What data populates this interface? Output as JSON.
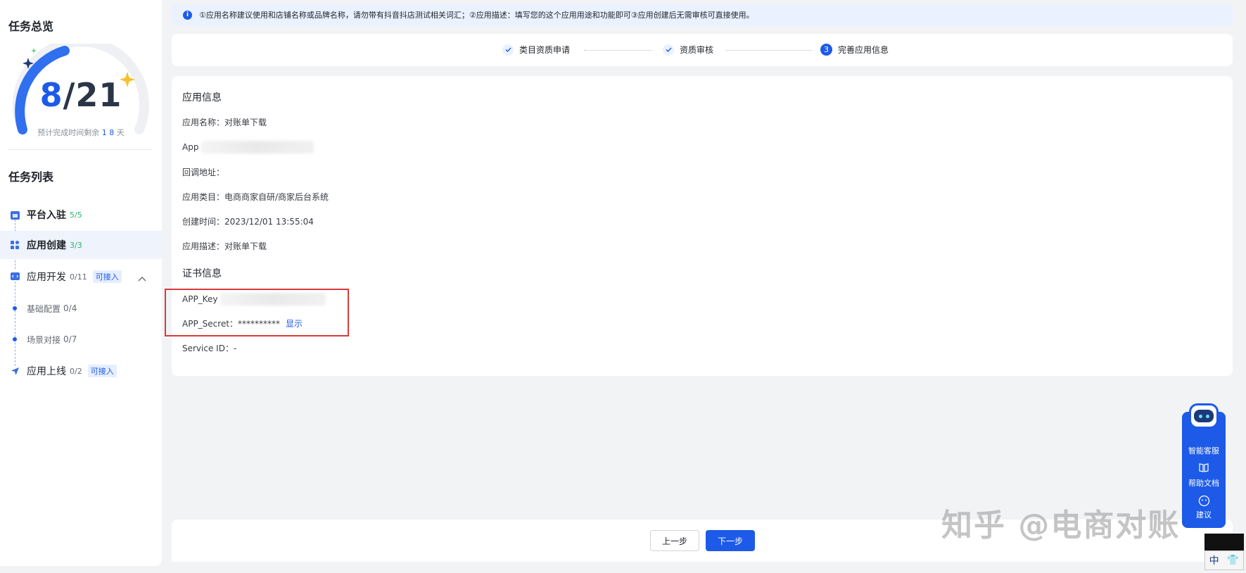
{
  "sidebar": {
    "overview_title": "任务总览",
    "progress": {
      "current": "8",
      "separator": "/",
      "total": "21",
      "fraction": 0.38
    },
    "estimate_prefix": "预计完成时间剩余",
    "estimate_value": "1 8",
    "estimate_suffix": "天",
    "list_title": "任务列表",
    "tasks": [
      {
        "name": "平台入驻",
        "count": "5/5"
      },
      {
        "name": "应用创建",
        "count": "3/3"
      },
      {
        "name": "应用开发",
        "count": "0/11",
        "badge": "可接入"
      },
      {
        "name": "应用上线",
        "count": "0/2",
        "badge": "可接入"
      }
    ],
    "subtasks": [
      {
        "name": "基础配置",
        "count": "0/4"
      },
      {
        "name": "场景对接",
        "count": "0/7"
      }
    ]
  },
  "notice": {
    "text": "①应用名称建议使用和店铺名称或品牌名称，请勿带有抖音抖店测试相关词汇；②应用描述：填写您的这个应用用途和功能即可③应用创建后无需审核可直接使用。"
  },
  "steps": [
    {
      "label": "类目资质申请",
      "status": "done"
    },
    {
      "label": "资质审核",
      "status": "done"
    },
    {
      "label": "完善应用信息",
      "status": "current",
      "number": "3"
    }
  ],
  "app_info": {
    "title": "应用信息",
    "name_label": "应用名称：",
    "name_value": "对账单下载",
    "appid_label": "App",
    "callback_label": "回调地址：",
    "category_label": "应用类目：",
    "category_value": "电商商家自研/商家后台系统",
    "created_label": "创建时间：",
    "created_value": "2023/12/01 13:55:04",
    "desc_label": "应用描述：",
    "desc_value": "对账单下载"
  },
  "cert_info": {
    "title": "证书信息",
    "key_label": "APP_Key",
    "secret_label": "APP_Secret：",
    "secret_value": "**********",
    "show_link": "显示",
    "service_label": "Service ID：",
    "service_value": "-"
  },
  "footer": {
    "prev": "上一步",
    "next": "下一步"
  },
  "assistant": {
    "service": "智能客服",
    "docs": "帮助文档",
    "feedback": "建议"
  },
  "watermark": "知乎 @电商对账",
  "ime": {
    "lang": "中",
    "skin": "👕"
  },
  "colors": {
    "primary": "#1d5ae8",
    "success": "#2bb36a",
    "highlight_box": "#d93a3a"
  }
}
